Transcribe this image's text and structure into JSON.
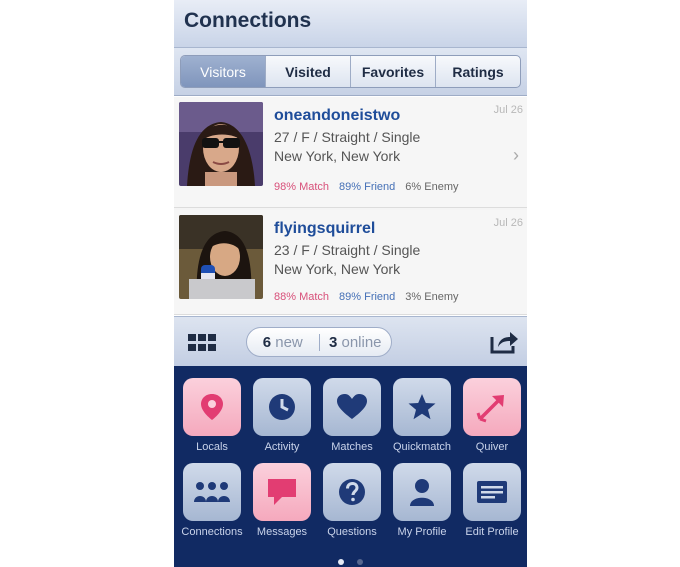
{
  "header": {
    "title": "Connections"
  },
  "tabs": [
    {
      "label": "Visitors",
      "active": true
    },
    {
      "label": "Visited"
    },
    {
      "label": "Favorites"
    },
    {
      "label": "Ratings"
    }
  ],
  "visitors": [
    {
      "username": "oneandoneistwo",
      "details": "27 / F / Straight / Single",
      "location": "New York, New York",
      "date": "Jul 26",
      "match": "98% Match",
      "friend": "89% Friend",
      "enemy": "6% Enemy"
    },
    {
      "username": "flyingsquirrel",
      "details": "23 / F / Straight / Single",
      "location": "New York, New York",
      "date": "Jul 26",
      "match": "88% Match",
      "friend": "89% Friend",
      "enemy": "3% Enemy"
    }
  ],
  "toolbar": {
    "new_count": "6",
    "new_label": "new",
    "online_count": "3",
    "online_label": "online"
  },
  "launcher": {
    "items": [
      {
        "label": "Locals",
        "icon": "map-pin-icon",
        "style": "pink"
      },
      {
        "label": "Activity",
        "icon": "clock-icon",
        "style": "blue"
      },
      {
        "label": "Matches",
        "icon": "heart-icon",
        "style": "blue"
      },
      {
        "label": "Quickmatch",
        "icon": "star-icon",
        "style": "blue"
      },
      {
        "label": "Quiver",
        "icon": "arrow-icon",
        "style": "pink"
      },
      {
        "label": "Connections",
        "icon": "people-icon",
        "style": "blue"
      },
      {
        "label": "Messages",
        "icon": "speech-bubble-icon",
        "style": "pink"
      },
      {
        "label": "Questions",
        "icon": "question-icon",
        "style": "blue"
      },
      {
        "label": "My Profile",
        "icon": "person-icon",
        "style": "blue"
      },
      {
        "label": "Edit Profile",
        "icon": "profile-card-icon",
        "style": "blue"
      }
    ]
  },
  "colors": {
    "brand_dark": "#112a63",
    "match_pink": "#d8507a",
    "friend_blue": "#4570b6",
    "username_blue": "#1f4d9a"
  }
}
